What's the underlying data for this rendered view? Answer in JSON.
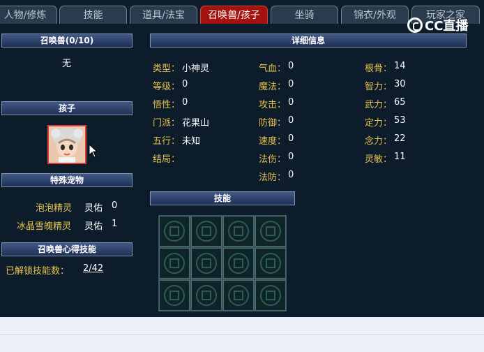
{
  "tabs": [
    {
      "label": "人物/修炼",
      "active": false
    },
    {
      "label": "技能",
      "active": false
    },
    {
      "label": "道具/法宝",
      "active": false
    },
    {
      "label": "召唤兽/孩子",
      "active": true
    },
    {
      "label": "坐骑",
      "active": false
    },
    {
      "label": "锦衣/外观",
      "active": false
    },
    {
      "label": "玩家之家",
      "active": false
    }
  ],
  "logo": {
    "text": "CC直播"
  },
  "summon": {
    "title": "召唤兽(0/10)",
    "empty_text": "无"
  },
  "child": {
    "title": "孩子"
  },
  "special_pets": {
    "title": "特殊宠物",
    "rows": [
      {
        "name": "泡泡精灵",
        "label": "灵佑",
        "value": "0"
      },
      {
        "name": "冰晶雪魄精灵",
        "label": "灵佑",
        "value": "1"
      }
    ]
  },
  "skill_insight": {
    "title": "召唤兽心得技能",
    "label": "已解锁技能数：",
    "value": "2/42"
  },
  "details": {
    "title": "详细信息",
    "col1": [
      {
        "label": "类型：",
        "value": "小神灵"
      },
      {
        "label": "等级：",
        "value": "0"
      },
      {
        "label": "悟性：",
        "value": "0"
      },
      {
        "label": "门派：",
        "value": "花果山"
      },
      {
        "label": "五行：",
        "value": "未知"
      },
      {
        "label": "结局：",
        "value": ""
      }
    ],
    "col2": [
      {
        "label": "气血：",
        "value": "0"
      },
      {
        "label": "魔法：",
        "value": "0"
      },
      {
        "label": "攻击：",
        "value": "0"
      },
      {
        "label": "防御：",
        "value": "0"
      },
      {
        "label": "速度：",
        "value": "0"
      },
      {
        "label": "法伤：",
        "value": "0"
      },
      {
        "label": "法防：",
        "value": "0"
      }
    ],
    "col3": [
      {
        "label": "根骨：",
        "value": "14"
      },
      {
        "label": "智力：",
        "value": "30"
      },
      {
        "label": "武力：",
        "value": "65"
      },
      {
        "label": "定力：",
        "value": "53"
      },
      {
        "label": "念力：",
        "value": "22"
      },
      {
        "label": "灵敏：",
        "value": "11"
      }
    ]
  },
  "skills": {
    "title": "技能",
    "slot_icon": "rune-slot-icon"
  },
  "colors": {
    "accent_label": "#e8c14e",
    "active_tab": "#a4120f",
    "panel": "#0c1c2b"
  }
}
